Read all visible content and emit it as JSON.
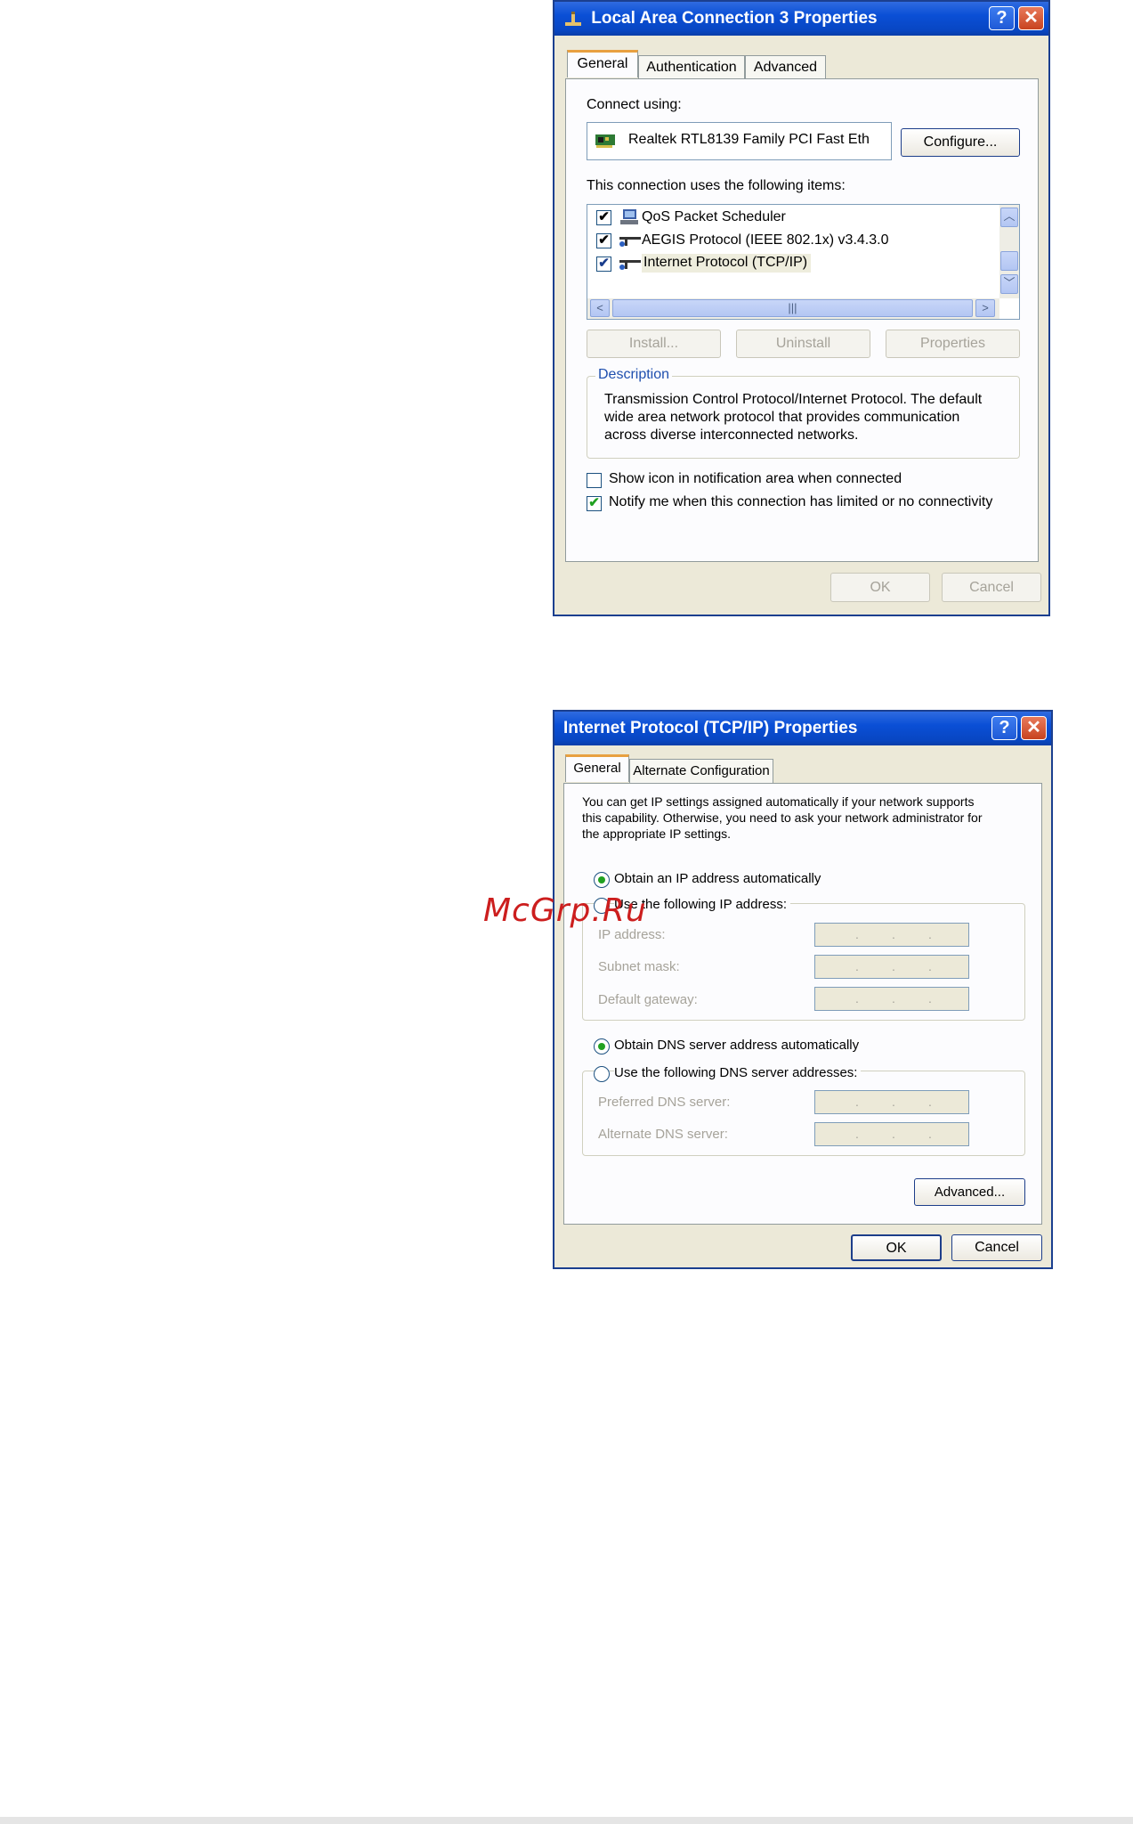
{
  "dialog1": {
    "title": "Local Area Connection 3 Properties",
    "tabs": [
      "General",
      "Authentication",
      "Advanced"
    ],
    "connect_using_label": "Connect using:",
    "adapter_name": "Realtek RTL8139 Family PCI Fast Eth",
    "configure_label": "Configure...",
    "items_label": "This connection uses the following items:",
    "items": [
      {
        "label": "QoS Packet Scheduler",
        "checked": true
      },
      {
        "label": "AEGIS Protocol (IEEE 802.1x) v3.4.3.0",
        "checked": true
      },
      {
        "label": "Internet Protocol (TCP/IP)",
        "checked": true
      }
    ],
    "install_label": "Install...",
    "uninstall_label": "Uninstall",
    "properties_label": "Properties",
    "description_title": "Description",
    "description_lines": [
      "Transmission Control Protocol/Internet Protocol. The default",
      "wide area network protocol that provides communication",
      "across diverse interconnected networks."
    ],
    "show_icon_label": "Show icon in notification area when connected",
    "notify_label": "Notify me when this connection has limited or no connectivity",
    "ok_label": "OK",
    "cancel_label": "Cancel",
    "help_glyph": "?",
    "close_glyph": "✕",
    "scroll_mark": "|||"
  },
  "dialog2": {
    "title": "Internet Protocol (TCP/IP) Properties",
    "tabs": [
      "General",
      "Alternate Configuration"
    ],
    "intro_lines": [
      "You can get IP settings assigned automatically if your network supports",
      "this capability. Otherwise, you need to ask your network administrator for",
      "the appropriate IP settings."
    ],
    "obtain_ip_label": "Obtain an IP address automatically",
    "use_ip_label": "Use the following IP address:",
    "ip_address_label": "IP address:",
    "subnet_label": "Subnet mask:",
    "gateway_label": "Default gateway:",
    "obtain_dns_label": "Obtain DNS server address automatically",
    "use_dns_label": "Use the following DNS server addresses:",
    "preferred_dns_label": "Preferred DNS server:",
    "alternate_dns_label": "Alternate DNS server:",
    "ip_dot": ".",
    "advanced_label": "Advanced...",
    "ok_label": "OK",
    "cancel_label": "Cancel",
    "help_glyph": "?",
    "close_glyph": "✕"
  },
  "watermark": "McGrp.Ru",
  "colors": {
    "title_bar": "#0a4fd6",
    "dialog_bg": "#ece9d8",
    "check_green": "#21a121",
    "watermark_red": "#cc1e1e",
    "tab_accent": "#e8a040"
  }
}
